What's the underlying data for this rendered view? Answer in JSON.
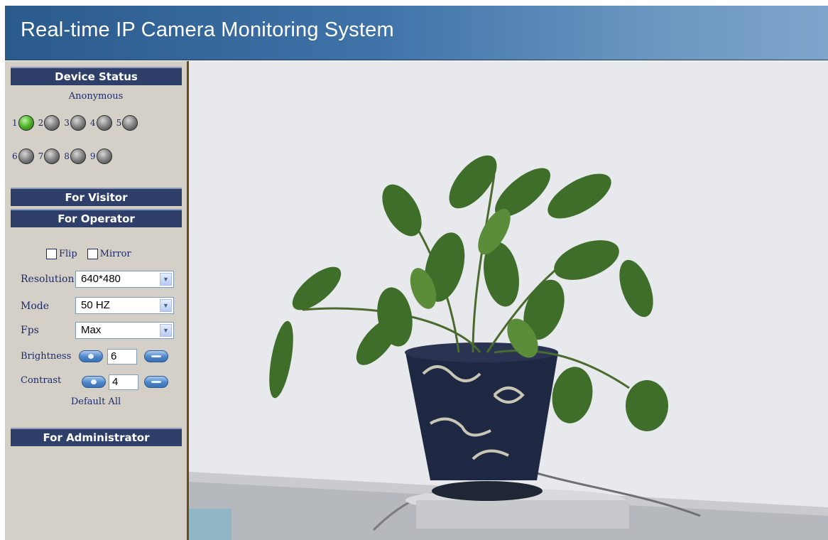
{
  "header": {
    "title": "Real-time IP Camera Monitoring System"
  },
  "device_status": {
    "heading": "Device Status",
    "user": "Anonymous",
    "cameras": [
      {
        "num": "1",
        "active": true
      },
      {
        "num": "2",
        "active": false
      },
      {
        "num": "3",
        "active": false
      },
      {
        "num": "4",
        "active": false
      },
      {
        "num": "5",
        "active": false
      },
      {
        "num": "6",
        "active": false
      },
      {
        "num": "7",
        "active": false
      },
      {
        "num": "8",
        "active": false
      },
      {
        "num": "9",
        "active": false
      }
    ]
  },
  "visitor": {
    "heading": "For Visitor"
  },
  "operator": {
    "heading": "For Operator",
    "flip_label": "Flip",
    "mirror_label": "Mirror",
    "resolution_label": "Resolution",
    "resolution_value": "640*480",
    "mode_label": "Mode",
    "mode_value": "50 HZ",
    "fps_label": "Fps",
    "fps_value": "Max",
    "brightness_label": "Brightness",
    "brightness_value": "6",
    "contrast_label": "Contrast",
    "contrast_value": "4",
    "default_all": "Default All"
  },
  "administrator": {
    "heading": "For Administrator"
  },
  "colors": {
    "header_blue": "#2b5a8c",
    "panel_navy": "#2e3f6a",
    "sidebar_gray": "#d4d0c8",
    "led_green": "#4fb32a"
  },
  "icons": {
    "active_led": "green-led-icon",
    "inactive_led": "gray-led-icon",
    "increase": "plus-button-icon",
    "decrease": "minus-button-icon",
    "dropdown": "chevron-down-icon"
  }
}
